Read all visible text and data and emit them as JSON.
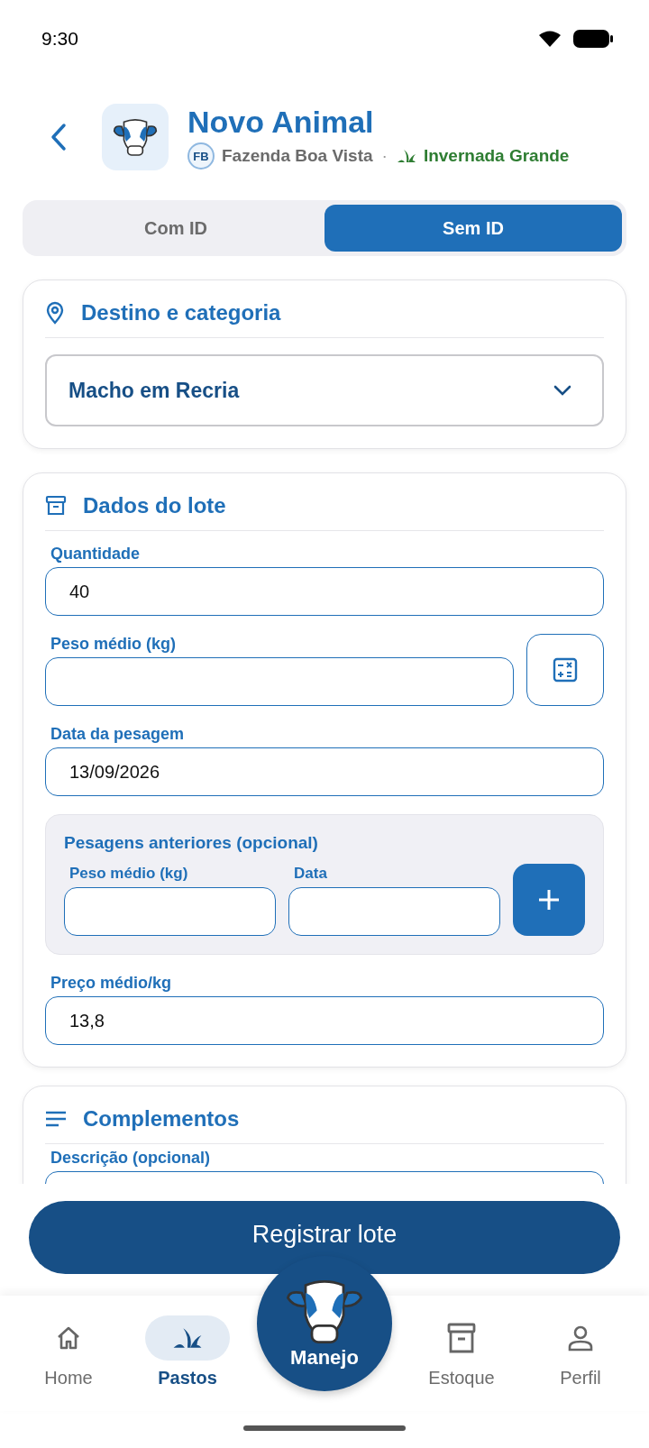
{
  "status_bar": {
    "time": "9:30"
  },
  "header": {
    "title": "Novo Animal",
    "farm_badge": "FB",
    "farm": "Fazenda Boa Vista",
    "separator": "·",
    "pasture": "Invernada Grande"
  },
  "tabs": [
    {
      "label": "Com ID",
      "selected": false
    },
    {
      "label": "Sem ID",
      "selected": true
    }
  ],
  "destination_card": {
    "title": "Destino e categoria",
    "category_select": {
      "value": "Macho em Recria"
    }
  },
  "batch_card": {
    "title": "Dados do lote",
    "fields": [
      {
        "label": "Quantidade",
        "value": "40",
        "kind": "plain"
      },
      {
        "label": "Peso médio (kg)",
        "kind": "calculator"
      },
      {
        "label": "Data da pesagem",
        "value": "13/09/2026",
        "kind": "plain"
      },
      {
        "kind": "history",
        "title": "Pesagens anteriores (opcional)",
        "weight_label": "Peso médio (kg)",
        "date_label": "Data"
      },
      {
        "label": "Preço médio/kg",
        "value": "13,8",
        "kind": "plain"
      }
    ]
  },
  "complements_card": {
    "title": "Complementos",
    "fields": [
      {
        "label": "Descrição (opcional)"
      }
    ]
  },
  "submit_button": "Registrar lote",
  "nav": [
    {
      "label": "Home",
      "kind": "home",
      "selected": false
    },
    {
      "label": "Pastos",
      "kind": "pastos",
      "selected": true
    },
    {
      "label": "Manejo",
      "kind": "center",
      "selected": false
    },
    {
      "label": "Estoque",
      "kind": "estoque",
      "selected": false
    },
    {
      "label": "Perfil",
      "kind": "perfil",
      "selected": false
    }
  ]
}
